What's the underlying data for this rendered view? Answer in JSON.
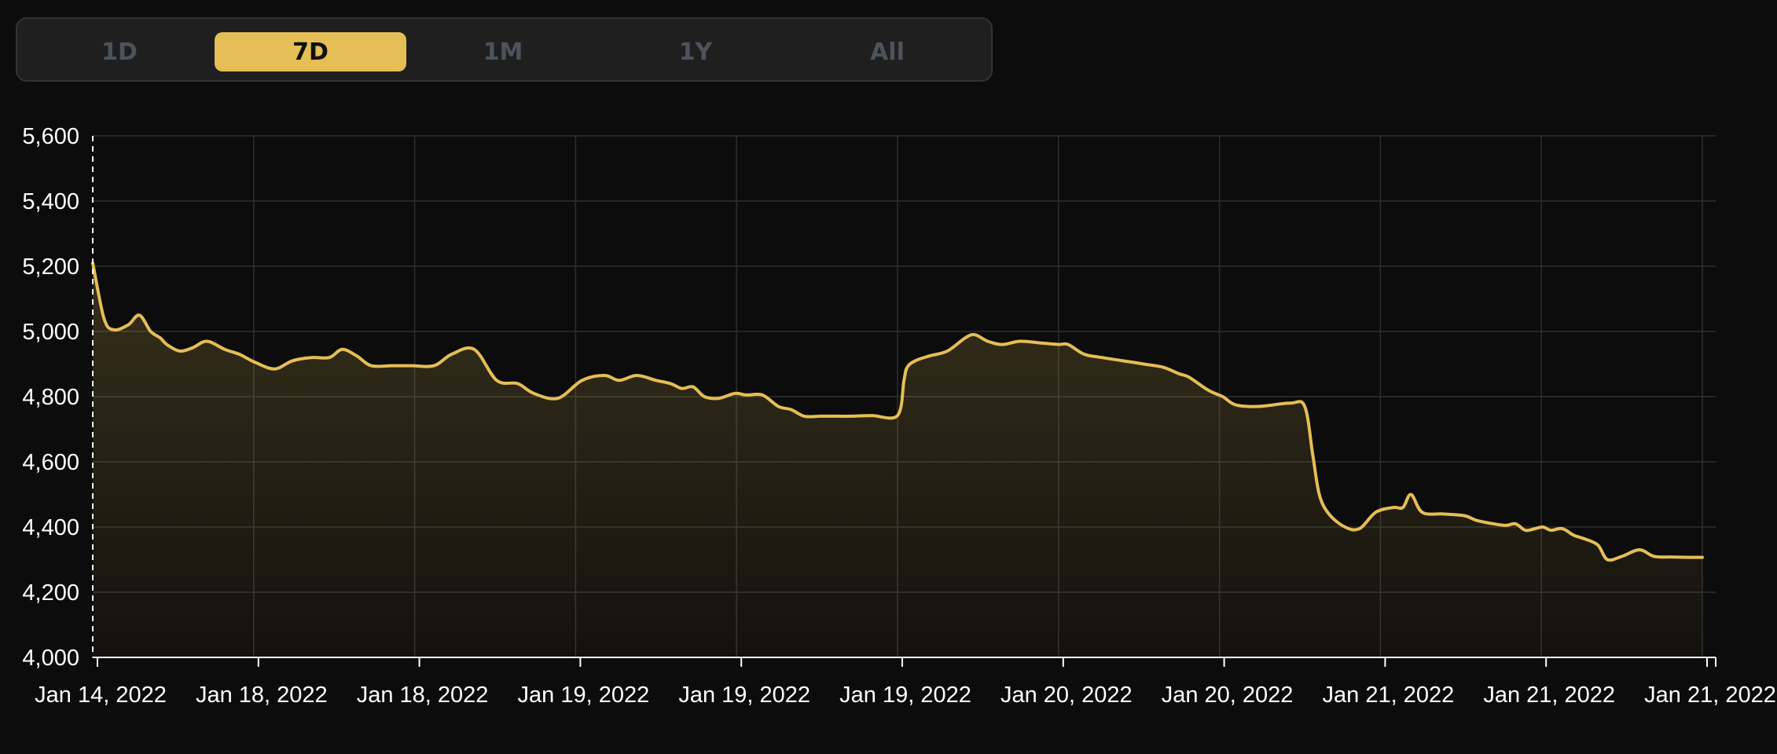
{
  "range_selector": {
    "options": [
      "1D",
      "7D",
      "1M",
      "1Y",
      "All"
    ],
    "active": "7D"
  },
  "colors": {
    "accent": "#e5be55",
    "background": "#0c0c0c",
    "grid": "#2e2e2e",
    "inactive_text": "#4d535c"
  },
  "chart_data": {
    "type": "area",
    "title": "",
    "xlabel": "",
    "ylabel": "",
    "ylim": [
      4000,
      5600
    ],
    "yticks": [
      4000,
      4200,
      4400,
      4600,
      4800,
      5000,
      5200,
      5400,
      5600
    ],
    "ytick_labels": [
      "4,000",
      "4,200",
      "4,400",
      "4,600",
      "4,800",
      "5,000",
      "5,200",
      "5,400",
      "5,600"
    ],
    "xtick_labels": [
      "Jan 14, 2022",
      "Jan 18, 2022",
      "Jan 18, 2022",
      "Jan 19, 2022",
      "Jan 19, 2022",
      "Jan 19, 2022",
      "Jan 20, 2022",
      "Jan 20, 2022",
      "Jan 21, 2022",
      "Jan 21, 2022",
      "Jan 21, 2022"
    ],
    "grid": true,
    "legend": "none",
    "series": [
      {
        "x": [
          0,
          0.7,
          1.3,
          2.2,
          2.9,
          3.6,
          4.2,
          4.6,
          5.4,
          6.2,
          7.1,
          8.2,
          9.1,
          10.1,
          11.3,
          12.4,
          13.6,
          14.7,
          15.5,
          16.4,
          17.3,
          18.6,
          19.8,
          21.2,
          22.3,
          23.7,
          25.1,
          26.4,
          27.4,
          28.9,
          30.4,
          31.8,
          32.7,
          33.8,
          35.0,
          35.9,
          36.6,
          37.3,
          38.0,
          38.9,
          39.9,
          40.6,
          41.6,
          42.6,
          43.4,
          44.2,
          45.2,
          46.0,
          47.1,
          48.4,
          50.0,
          50.4,
          50.6,
          51.1,
          52.0,
          53.1,
          54.2,
          54.8,
          55.6,
          56.5,
          57.6,
          58.8,
          60.0,
          60.6,
          61.6,
          62.7,
          64.0,
          65.3,
          66.5,
          67.5,
          68.1,
          69.3,
          70.2,
          71.0,
          72.4,
          74.4,
          75.3,
          75.8,
          76.2,
          76.8,
          77.8,
          78.7,
          79.7,
          80.8,
          81.4,
          81.9,
          82.6,
          83.9,
          85.2,
          86.0,
          87.0,
          87.8,
          88.4,
          89.0,
          89.6,
          90.1,
          90.6,
          91.3,
          92.0,
          92.6,
          93.5,
          94.1,
          95.0,
          96.1,
          97.0,
          98.2,
          99.2,
          100.0
        ],
        "y": [
          5210,
          5040,
          5005,
          5020,
          5050,
          5000,
          4980,
          4960,
          4940,
          4950,
          4970,
          4945,
          4930,
          4905,
          4885,
          4910,
          4920,
          4920,
          4945,
          4925,
          4895,
          4895,
          4895,
          4895,
          4930,
          4945,
          4850,
          4840,
          4810,
          4795,
          4850,
          4865,
          4850,
          4865,
          4850,
          4840,
          4825,
          4830,
          4800,
          4795,
          4810,
          4805,
          4805,
          4770,
          4760,
          4740,
          4740,
          4740,
          4740,
          4742,
          4742,
          4850,
          4890,
          4910,
          4925,
          4940,
          4980,
          4990,
          4970,
          4960,
          4970,
          4965,
          4960,
          4960,
          4930,
          4920,
          4910,
          4900,
          4890,
          4870,
          4860,
          4820,
          4800,
          4775,
          4770,
          4780,
          4770,
          4620,
          4500,
          4440,
          4400,
          4395,
          4445,
          4460,
          4460,
          4500,
          4445,
          4440,
          4435,
          4420,
          4410,
          4405,
          4410,
          4390,
          4395,
          4400,
          4390,
          4395,
          4375,
          4365,
          4345,
          4300,
          4310,
          4330,
          4310,
          4308,
          4307,
          4307
        ]
      }
    ]
  }
}
